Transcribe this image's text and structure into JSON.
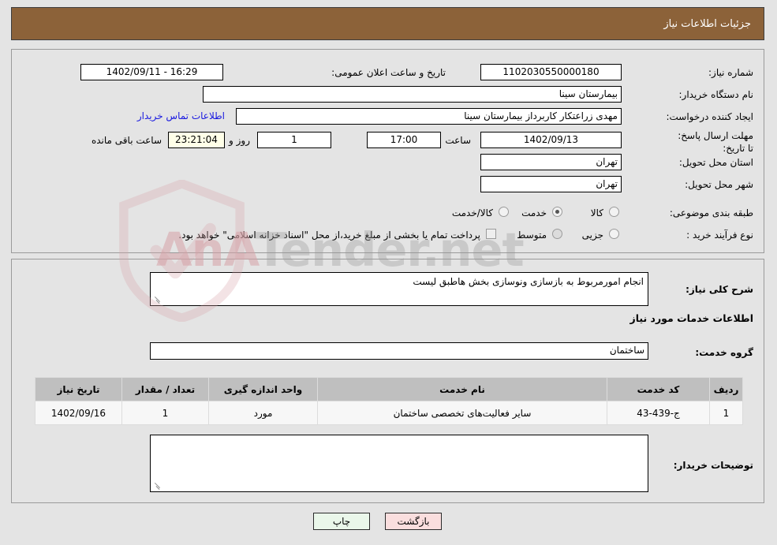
{
  "header": {
    "title": "جزئیات اطلاعات نیاز"
  },
  "top_section": {
    "need_number_label": "شماره نیاز:",
    "need_number_value": "1102030550000180",
    "announce_datetime_label": "تاریخ و ساعت اعلان عمومی:",
    "announce_datetime_value": "16:29 - 1402/09/11",
    "buyer_org_label": "نام دستگاه خریدار:",
    "buyer_org_value": "بیمارستان سینا",
    "requester_label": "ایجاد کننده درخواست:",
    "requester_value": "مهدی  زراعتکار  کاربرداز بیمارستان سینا",
    "contact_link": "اطلاعات تماس خریدار",
    "deadline_label": "مهلت ارسال پاسخ: تا تاریخ:",
    "deadline_date": "1402/09/13",
    "hour_label": "ساعت",
    "hour_value": "17:00",
    "days_value": "1",
    "days_and_label": "روز و",
    "countdown_value": "23:21:04",
    "remaining_label": "ساعت باقی مانده",
    "province_label": "استان محل تحویل:",
    "province_value": "تهران",
    "city_label": "شهر محل تحویل:",
    "city_value": "تهران",
    "category_label": "طبقه بندی موضوعی:",
    "category_options": [
      {
        "label": "کالا",
        "selected": false
      },
      {
        "label": "خدمت",
        "selected": true
      },
      {
        "label": "کالا/خدمت",
        "selected": false
      }
    ],
    "process_label": "نوع فرآیند خرید :",
    "process_options": [
      {
        "label": "جزیی",
        "selected": false
      },
      {
        "label": "متوسط",
        "selected": false
      }
    ],
    "treasury_note": "پرداخت تمام یا بخشی از مبلغ خرید،از محل \"اسناد خزانه اسلامی\" خواهد بود."
  },
  "mid_section": {
    "general_desc_label": "شرح کلی نیاز:",
    "general_desc_value": "انجام امورمربوط به بازسازی ونوسازی بخش هاطبق لیست",
    "services_heading": "اطلاعات خدمات مورد نیاز",
    "service_group_label": "گروه خدمت:",
    "service_group_value": "ساختمان",
    "buyer_notes_label": "توضیحات خریدار:",
    "buyer_notes_value": ""
  },
  "table": {
    "columns": [
      "ردیف",
      "کد خدمت",
      "نام خدمت",
      "واحد اندازه گیری",
      "تعداد / مقدار",
      "تاریخ نیاز"
    ],
    "rows": [
      [
        "1",
        "ج-439-43",
        "سایر فعالیت‌های تخصصی ساختمان",
        "مورد",
        "1",
        "1402/09/16"
      ]
    ]
  },
  "footer": {
    "print_label": "چاپ",
    "back_label": "بازگشت"
  },
  "watermark": {
    "text_left": "AnA",
    "text_right": "Tender.net"
  },
  "colors": {
    "header_brown": "#8c6239",
    "page_bg": "#e4e4e4",
    "link_blue": "#1818e0",
    "countdown_bg": "#ffffe8",
    "print_btn_bg": "#eaf7ea",
    "back_btn_bg": "#fadede",
    "table_header_bg": "#bfbfbf"
  }
}
